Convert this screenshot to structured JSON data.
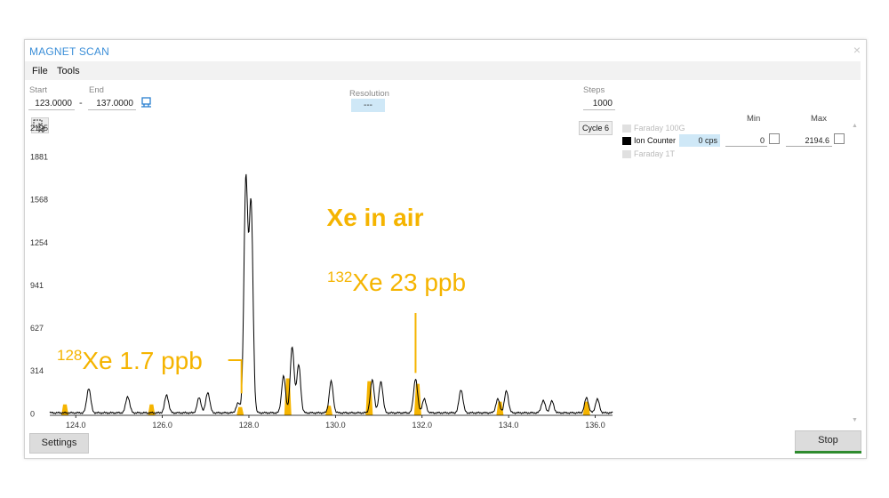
{
  "window": {
    "title": "MAGNET SCAN",
    "close": "×"
  },
  "menu": {
    "file": "File",
    "tools": "Tools"
  },
  "scan": {
    "start_label": "Start",
    "start_value": "123.0000",
    "end_label": "End",
    "end_value": "137.0000",
    "separator": "-",
    "resolution_label": "Resolution",
    "resolution_value": "---",
    "steps_label": "Steps",
    "steps_value": "1000"
  },
  "plot": {
    "cycle_label": "Cycle 6"
  },
  "detectors": {
    "min_header": "Min",
    "max_header": "Max",
    "items": [
      {
        "name": "Faraday 100G",
        "color": "#e0e0e0",
        "active": false
      },
      {
        "name": "Ion Counter",
        "color": "#000000",
        "active": true
      },
      {
        "name": "Faraday 1T",
        "color": "#e0e0e0",
        "active": false
      }
    ],
    "ion_counter_cps": "0 cps",
    "min_value": "0",
    "max_value": "2194.6"
  },
  "buttons": {
    "settings": "Settings",
    "stop": "Stop"
  },
  "chart_data": {
    "type": "line",
    "title": "Xe in air",
    "xlim": [
      123.4,
      136.4
    ],
    "ylim": [
      -10,
      2100
    ],
    "xticks": [
      "124.0",
      "126.0",
      "128.0",
      "130.0",
      "132.0",
      "134.0",
      "136.0"
    ],
    "yticks": [
      "0",
      "314",
      "627",
      "941",
      "1254",
      "1568",
      "1881",
      "2195"
    ],
    "annotations": [
      {
        "mass": "128",
        "text": "Xe 1.7 ppb",
        "x": 127.85,
        "y": 150
      },
      {
        "mass": "132",
        "text": "Xe  23 ppb",
        "x": 131.85,
        "y": 300
      }
    ],
    "series": [
      {
        "color": "#000000",
        "peaks": [
          [
            124.3,
            180
          ],
          [
            125.2,
            120
          ],
          [
            126.1,
            130
          ],
          [
            126.85,
            110
          ],
          [
            127.05,
            150
          ],
          [
            127.75,
            70
          ],
          [
            127.93,
            1700
          ],
          [
            128.05,
            1520
          ],
          [
            128.8,
            270
          ],
          [
            129.0,
            480
          ],
          [
            129.15,
            350
          ],
          [
            129.9,
            230
          ],
          [
            130.85,
            240
          ],
          [
            131.05,
            230
          ],
          [
            131.85,
            250
          ],
          [
            132.05,
            100
          ],
          [
            132.9,
            170
          ],
          [
            133.75,
            100
          ],
          [
            133.95,
            160
          ],
          [
            134.8,
            90
          ],
          [
            135.0,
            85
          ],
          [
            135.8,
            110
          ],
          [
            136.05,
            100
          ]
        ]
      },
      {
        "color": "#f5b400",
        "regions": [
          [
            123.75,
            70
          ],
          [
            125.75,
            70
          ],
          [
            127.8,
            50
          ],
          [
            128.9,
            260
          ],
          [
            129.85,
            60
          ],
          [
            130.78,
            240
          ],
          [
            131.9,
            220
          ],
          [
            133.8,
            90
          ],
          [
            135.8,
            90
          ]
        ]
      }
    ]
  }
}
